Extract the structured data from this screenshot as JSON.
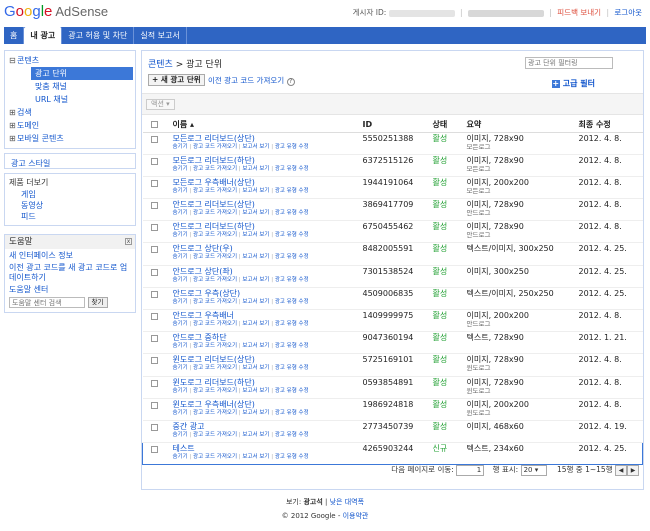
{
  "header": {
    "logo_google": [
      "G",
      "o",
      "o",
      "g",
      "l",
      "e"
    ],
    "logo_product": "AdSense",
    "publisher_label": "게시자 ID:",
    "feedback": "피드백 보내기",
    "logout": "로그아웃"
  },
  "nav": {
    "tabs": [
      {
        "label": "홈",
        "active": false
      },
      {
        "label": "내 광고",
        "active": true
      },
      {
        "label": "광고 허용 및 차단",
        "active": false
      },
      {
        "label": "실적 보고서",
        "active": false
      }
    ]
  },
  "sidebar": {
    "content": "콘텐츠",
    "ad_units": "광고 단위",
    "custom_channels": "맞춤 채널",
    "url_channels": "URL 채널",
    "search": "검색",
    "domains": "도메인",
    "mobile_content": "모바일 콘텐츠",
    "ad_style": "광고 스타일",
    "products_title": "제품 더보기",
    "games": "게임",
    "video": "동영상",
    "feeds": "피드",
    "help_title": "도움말",
    "help_close": "x",
    "help_links": [
      "새 인터페이스 정보",
      "이전 광고 코드를 새 광고 코드로 업데이트하기"
    ],
    "help_center": "도움말 센터",
    "help_search_placeholder": "도움말 센터 검색",
    "help_search_btn": "찾기"
  },
  "main": {
    "breadcrumb_root": "콘텐츠",
    "breadcrumb_sep": ">",
    "breadcrumb_current": "광고 단위",
    "filter_placeholder": "광고 단위 필터링",
    "new_unit_btn": "+ 새 광고 단위",
    "prev_code_link": "이전 광고 코드 가져오기",
    "help_q": "?",
    "adv_filter_plus": "+",
    "adv_filter": "고급 필터",
    "action_btn": "액션 ▾",
    "columns": {
      "name": "이름 ▴",
      "id": "ID",
      "status": "상태",
      "summary": "요약",
      "modified": "최종 수정"
    },
    "row_actions": [
      "광고 코드 가져오기",
      "보고서 보기",
      "광고 유형 수정"
    ],
    "row_action_first": "숨기기",
    "row_actions_sep": "|",
    "rows": [
      {
        "name": "모든로그 리더보드(상단)",
        "id": "5550251388",
        "status": "활성",
        "summary": "이미지, 728x90",
        "sub": "모든로그",
        "date": "2012. 4. 8."
      },
      {
        "name": "모든로그 리더보드(하단)",
        "id": "6372515126",
        "status": "활성",
        "summary": "이미지, 728x90",
        "sub": "모든로그",
        "date": "2012. 4. 8."
      },
      {
        "name": "모든로그 우측배너(상단)",
        "id": "1944191064",
        "status": "활성",
        "summary": "이미지, 200x200",
        "sub": "모든로그",
        "date": "2012. 4. 8."
      },
      {
        "name": "안드로그 리더보드(상단)",
        "id": "3869417709",
        "status": "활성",
        "summary": "이미지, 728x90",
        "sub": "안드로그",
        "date": "2012. 4. 8."
      },
      {
        "name": "안드로그 리더보드(하단)",
        "id": "6750455462",
        "status": "활성",
        "summary": "이미지, 728x90",
        "sub": "안드로그",
        "date": "2012. 4. 8."
      },
      {
        "name": "안드로그 상단(우)",
        "id": "8482005591",
        "status": "활성",
        "summary": "텍스트/이미지, 300x250",
        "sub": "",
        "date": "2012. 4. 25."
      },
      {
        "name": "안드로그 상단(좌)",
        "id": "7301538524",
        "status": "활성",
        "summary": "이미지, 300x250",
        "sub": "",
        "date": "2012. 4. 25."
      },
      {
        "name": "안드로그 우측(상단)",
        "id": "4509006835",
        "status": "활성",
        "summary": "텍스트/이미지, 250x250",
        "sub": "",
        "date": "2012. 4. 25."
      },
      {
        "name": "안드로그 우측배너",
        "id": "1409999975",
        "status": "활성",
        "summary": "이미지, 200x200",
        "sub": "안드로그",
        "date": "2012. 4. 8."
      },
      {
        "name": "안드로그 중하단",
        "id": "9047360194",
        "status": "활성",
        "summary": "텍스트, 728x90",
        "sub": "",
        "date": "2012. 1. 21."
      },
      {
        "name": "윈도로그 리더보드(상단)",
        "id": "5725169101",
        "status": "활성",
        "summary": "이미지, 728x90",
        "sub": "윈도로그",
        "date": "2012. 4. 8."
      },
      {
        "name": "윈도로그 리더보드(하단)",
        "id": "0593854891",
        "status": "활성",
        "summary": "이미지, 728x90",
        "sub": "윈도로그",
        "date": "2012. 4. 8."
      },
      {
        "name": "윈도로그 우측배너(상단)",
        "id": "1986924818",
        "status": "활성",
        "summary": "이미지, 200x200",
        "sub": "윈도로그",
        "date": "2012. 4. 8."
      },
      {
        "name": "중간 광고",
        "id": "2773450739",
        "status": "활성",
        "summary": "이미지, 468x60",
        "sub": "",
        "date": "2012. 4. 19."
      },
      {
        "name": "테스트",
        "id": "4265903244",
        "status": "신규",
        "summary": "텍스트, 234x60",
        "sub": "",
        "date": "2012. 4. 25."
      }
    ],
    "pager": {
      "goto_label": "다음 페이지로 이동:",
      "page": "1",
      "rows_label": "행 표시:",
      "rows_value": "20 ▾",
      "range": "15행 중 1~15행",
      "prev": "◀",
      "next": "▶"
    }
  },
  "footer": {
    "view_label": "보기:",
    "view_current": "광고석",
    "view_sep": "|",
    "view_other": "낮은 대역폭",
    "copyright": "© 2012 Google -",
    "terms": "이용약관"
  }
}
